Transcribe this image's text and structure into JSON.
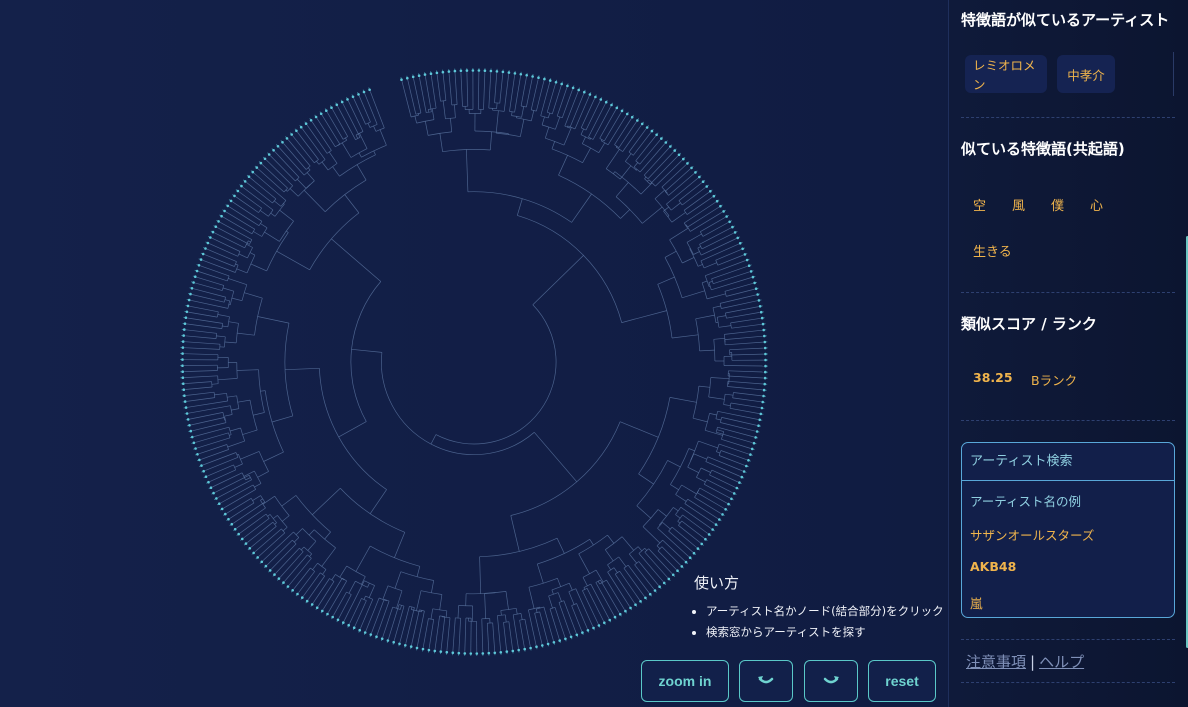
{
  "howto": {
    "title": "使い方",
    "items": [
      "アーティスト名かノード(結合部分)をクリック",
      "検索窓からアーティストを探す"
    ]
  },
  "controls": {
    "zoom_in": "zoom in",
    "rotate_left_icon": "rotate-ccw-icon",
    "rotate_right_icon": "rotate-cw-icon",
    "reset": "reset"
  },
  "panel": {
    "similar_artists": {
      "title": "特徴語が似ているアーティスト",
      "items": [
        "レミオロメン",
        "中孝介"
      ]
    },
    "similar_words": {
      "title": "似ている特徴語(共起語)",
      "words": [
        "空",
        "風",
        "僕",
        "心",
        "生きる"
      ]
    },
    "score": {
      "title": "類似スコア / ランク",
      "value": "38.25",
      "rank": "Bランク"
    },
    "search": {
      "placeholder": "アーティスト検索",
      "example_label": "アーティスト名の例",
      "examples": [
        "サザンオールスターズ",
        "AKB48",
        "嵐"
      ]
    },
    "links": {
      "notes": "注意事項",
      "separator": "|",
      "help": "ヘルプ"
    }
  },
  "colors": {
    "background": "#111d44",
    "accent_teal": "#6fd3d0",
    "accent_orange": "#f0b44c",
    "tree_line": "#5f7aa6",
    "leaf_dot": "#5ec7d8"
  }
}
